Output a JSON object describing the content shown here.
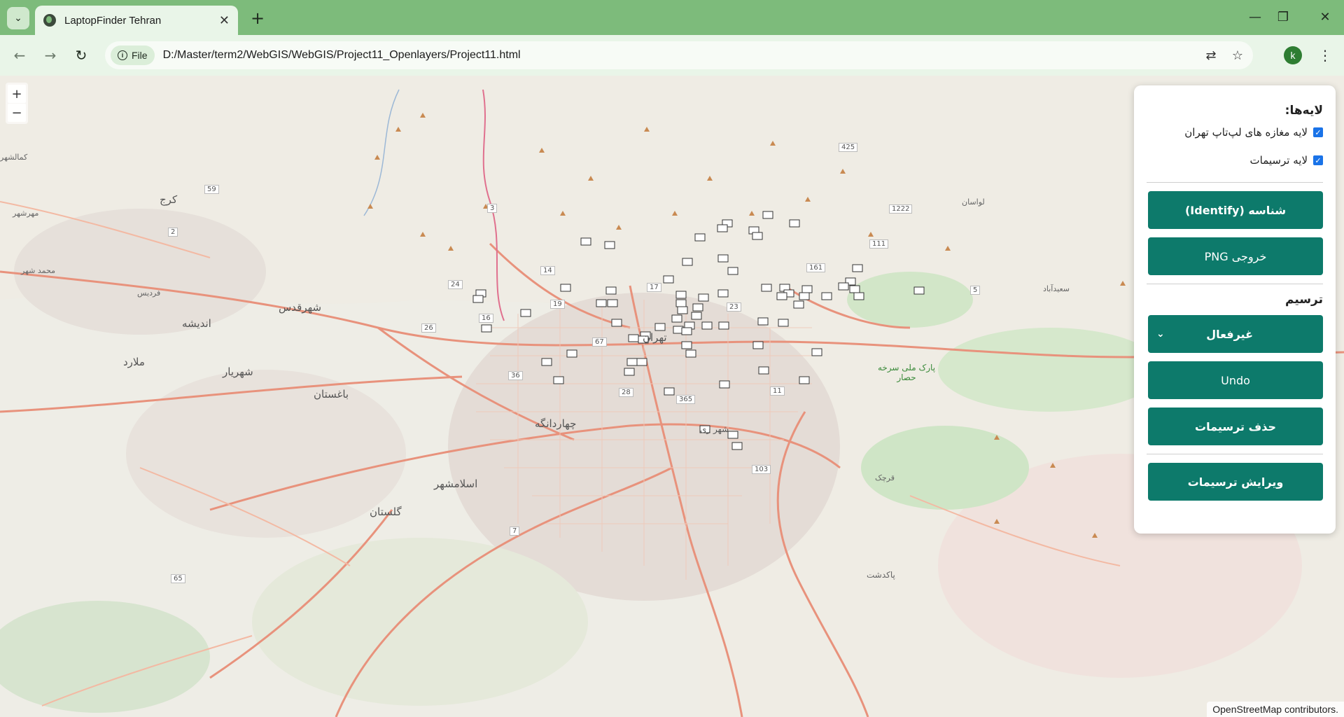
{
  "browser": {
    "tab_title": "LaptopFinder Tehran",
    "file_chip": "File",
    "url": "D:/Master/term2/WebGIS/WebGIS/Project11_Openlayers/Project11.html",
    "avatar_letter": "k"
  },
  "map": {
    "zoom_in": "+",
    "zoom_out": "−",
    "attribution": "OpenStreetMap contributors.",
    "labels": {
      "karaj": "کرج",
      "tehran": "تهران",
      "shahr_qods": "شهرقدس",
      "andisheh": "اندیشه",
      "shahriar": "شهریار",
      "malard": "ملارد",
      "baghestan": "باغستان",
      "chahardangeh": "چهاردانگه",
      "eslamshahr": "اسلامشهر",
      "golestan": "گلستان",
      "pakdasht": "پاکدشت",
      "mehrshahr": "مهرشهر",
      "mohammadshahr": "محمد شهر",
      "fardis": "فردیس",
      "kamalshahr": "کمالشهر",
      "lavasan": "لواسان",
      "pardis_park": "پارک ملی سرخه حصار",
      "saeedabad": "سعیدآباد",
      "qarchak": "قرچک",
      "shahr_rey": "شهر ری"
    },
    "route_numbers": {
      "r59": "59",
      "r2": "2",
      "r3": "3",
      "r425": "425",
      "r1222": "1222",
      "r111": "111",
      "r161": "161",
      "r5": "5",
      "r14": "14",
      "r24": "24",
      "r17": "17",
      "r19": "19",
      "r23": "23",
      "r16": "16",
      "r26": "26",
      "r67": "67",
      "r36": "36",
      "r28": "28",
      "r365": "365",
      "r11": "11",
      "r103": "103",
      "r7": "7",
      "r65": "65"
    }
  },
  "panel": {
    "layers_title": "لایه‌ها:",
    "layer_shops": "لایه مغازه های لپ‌تاپ تهران",
    "layer_drawings": "لایه ترسیمات",
    "identify": "شناسه (Identify)",
    "export_png": "خروجی PNG",
    "draw_title": "ترسیم",
    "draw_mode": "غیرفعال",
    "undo": "Undo",
    "delete_drawings": "حذف ترسیمات",
    "edit_drawings": "ویرایش ترسیمات"
  }
}
